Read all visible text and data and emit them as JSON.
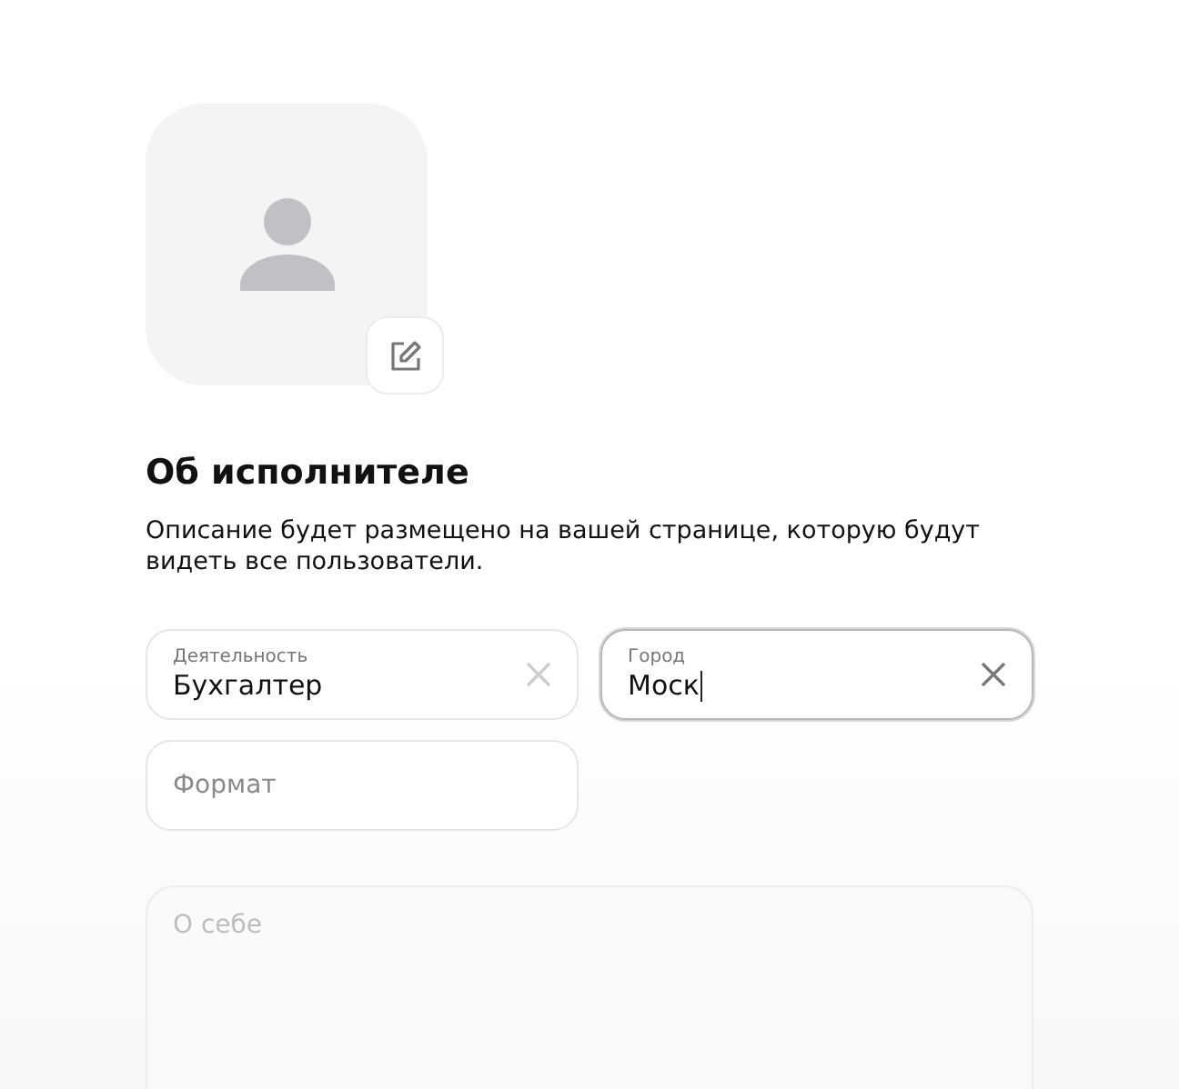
{
  "profile": {
    "avatar": {
      "kind": "placeholder"
    },
    "edit_button": {
      "kind": "icon"
    }
  },
  "section": {
    "title": "Об исполнителе",
    "description": "Описание будет размещено на вашей странице, которую будут видеть все пользователи."
  },
  "fields": [
    {
      "label": "Деятельность",
      "value": "Бухгалтер",
      "focused": false
    },
    {
      "label": "Город",
      "value": "Моск",
      "focused": true
    },
    {
      "placeholder": "Формат",
      "focused": false
    }
  ],
  "about": {
    "placeholder": "О себе"
  }
}
